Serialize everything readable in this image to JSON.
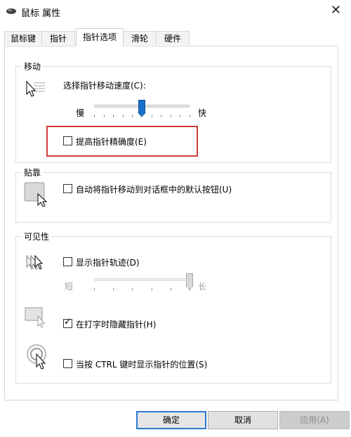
{
  "window": {
    "title": "鼠标 属性",
    "close_glyph": "✕"
  },
  "tabs": [
    {
      "label": "鼠标键",
      "active": false
    },
    {
      "label": "指针",
      "active": false
    },
    {
      "label": "指针选项",
      "active": true
    },
    {
      "label": "滑轮",
      "active": false
    },
    {
      "label": "硬件",
      "active": false
    }
  ],
  "motion": {
    "legend": "移动",
    "speed_label": "选择指针移动速度(C):",
    "slow_label": "慢",
    "fast_label": "快",
    "speed_value_fraction": 0.5,
    "enhance_precision": {
      "label": "提高指针精确度(E)",
      "checked": false
    }
  },
  "snap": {
    "legend": "贴靠",
    "snap_to": {
      "label": "自动将指针移动到对话框中的默认按钮(U)",
      "checked": false
    }
  },
  "visibility": {
    "legend": "可见性",
    "trails": {
      "label": "显示指针轨迹(D)",
      "checked": false
    },
    "short_label": "短",
    "long_label": "长",
    "trail_length_fraction": 1.0,
    "hide_typing": {
      "label": "在打字时隐藏指针(H)",
      "checked": true
    },
    "show_ctrl": {
      "label": "当按 CTRL 键时显示指针的位置(S)",
      "checked": false
    }
  },
  "buttons": {
    "ok": "确定",
    "cancel": "取消",
    "apply": "应用(A)"
  },
  "colors": {
    "accent": "#1a70c8",
    "highlight": "#d23a3a"
  }
}
